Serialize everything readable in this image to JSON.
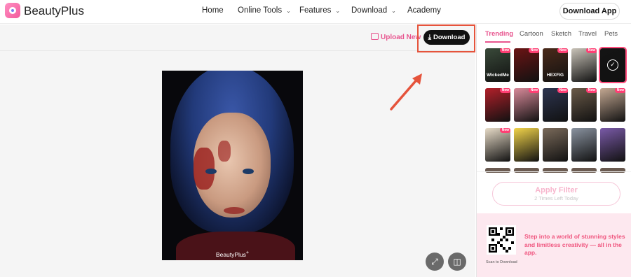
{
  "header": {
    "brand": "BeautyPlus",
    "nav": [
      {
        "label": "Home",
        "dropdown": false
      },
      {
        "label": "Online Tools",
        "dropdown": true
      },
      {
        "label": "Features",
        "dropdown": true
      },
      {
        "label": "Download",
        "dropdown": true
      },
      {
        "label": "Academy",
        "dropdown": false
      }
    ],
    "download_app": "Download App"
  },
  "toolbar": {
    "upload_new": "Upload New",
    "download": "Download",
    "highlight_color": "#e5533b"
  },
  "canvas": {
    "watermark": "BeautyPlus"
  },
  "panel": {
    "tabs": [
      "Trending",
      "Cartoon",
      "Sketch",
      "Travel",
      "Pets"
    ],
    "active_tab": "Trending",
    "filters": [
      {
        "name": "WickedMe",
        "caption": "WickedMe",
        "new": true,
        "bg": "#3a4a3a"
      },
      {
        "name": "red-dark",
        "caption": "",
        "new": true,
        "bg": "#6b1414"
      },
      {
        "name": "HEXFIG",
        "caption": "HEXFIG",
        "new": true,
        "bg": "#4a2a1a"
      },
      {
        "name": "suit",
        "caption": "",
        "new": true,
        "bg": "#c9c3b8"
      },
      {
        "name": "selected-dark",
        "caption": "",
        "new": false,
        "bg": "#141414",
        "selected": true
      },
      {
        "name": "red-poster",
        "caption": "",
        "new": true,
        "bg": "#b3202a"
      },
      {
        "name": "pink-group",
        "caption": "",
        "new": true,
        "bg": "#d98a9a"
      },
      {
        "name": "blue-poster",
        "caption": "",
        "new": true,
        "bg": "#2d3550"
      },
      {
        "name": "sepia-duo",
        "caption": "",
        "new": true,
        "bg": "#6a5a48"
      },
      {
        "name": "grid-faces",
        "caption": "",
        "new": true,
        "bg": "#c4a892"
      },
      {
        "name": "bears",
        "caption": "",
        "new": true,
        "bg": "#e8dcc8"
      },
      {
        "name": "cartoon-yellow",
        "caption": "",
        "new": false,
        "bg": "#f2d44a"
      },
      {
        "name": "man-street",
        "caption": "",
        "new": false,
        "bg": "#7a6a5a"
      },
      {
        "name": "two-men",
        "caption": "",
        "new": false,
        "bg": "#8a93a0"
      },
      {
        "name": "purple-girl",
        "caption": "",
        "new": false,
        "bg": "#7a5aa8"
      }
    ],
    "apply_label": "Apply Filter",
    "apply_sub": "2 Times Left Today",
    "qr_caption": "Scan to Download",
    "promo": "Step into a world of stunning styles and limitless creativity — all in the app.",
    "accent": "#e8558f"
  }
}
